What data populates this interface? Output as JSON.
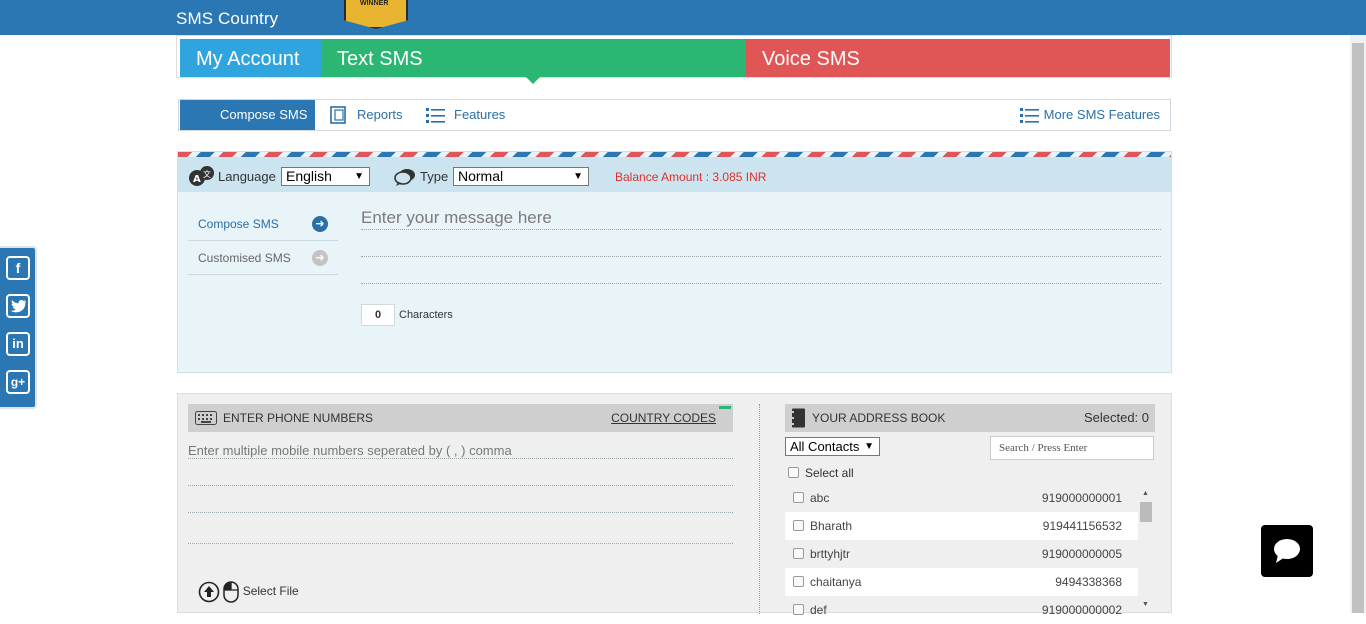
{
  "header": {
    "brand": "SMS Country",
    "award_text": "WINNER"
  },
  "main_tabs": [
    {
      "label": "My Account"
    },
    {
      "label": "Text SMS"
    },
    {
      "label": "Voice SMS"
    }
  ],
  "subnav": {
    "compose": "Compose SMS",
    "reports": "Reports",
    "features": "Features",
    "more": "More SMS Features"
  },
  "compose": {
    "language_label": "Language",
    "language_value": "English",
    "type_label": "Type",
    "type_value": "Normal",
    "balance": "Balance Amount : 3.085 INR",
    "menu": [
      {
        "label": "Compose SMS"
      },
      {
        "label": "Customised SMS"
      }
    ],
    "message_placeholder": "Enter your message here",
    "char_count": "0",
    "char_label": "Characters"
  },
  "phone": {
    "header": "ENTER PHONE NUMBERS",
    "country_codes": "COUNTRY CODES",
    "placeholder": "Enter multiple mobile numbers seperated by ( , ) comma",
    "select_file": "Select File"
  },
  "addressbook": {
    "header": "YOUR ADDRESS BOOK",
    "selected": "Selected: 0",
    "filter": "All Contacts",
    "search_placeholder": "Search / Press Enter",
    "select_all": "Select all",
    "contacts": [
      {
        "name": "abc",
        "number": "919000000001"
      },
      {
        "name": "Bharath",
        "number": "919441156532"
      },
      {
        "name": "brttyhjtr",
        "number": "919000000005"
      },
      {
        "name": "chaitanya",
        "number": "9494338368"
      },
      {
        "name": "def",
        "number": "919000000002"
      }
    ]
  },
  "colors": {
    "header_blue": "#2a77b3",
    "text_sms_green": "#2bb673",
    "voice_red": "#e05555",
    "balance_red": "#e0302b"
  }
}
